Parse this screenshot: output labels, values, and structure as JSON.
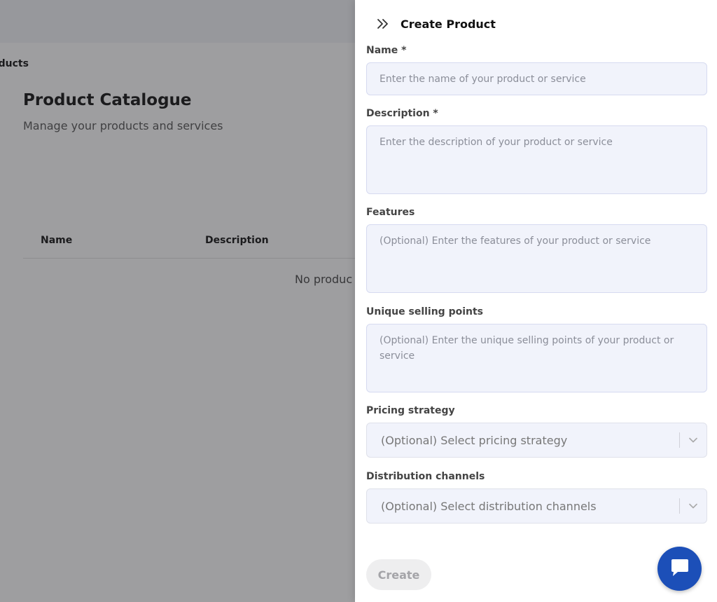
{
  "background": {
    "breadcrumb": "oducts",
    "title": "Product Catalogue",
    "subtitle": "Manage your products and services",
    "table": {
      "headers": [
        "Name",
        "Description"
      ],
      "empty_text": "No produc"
    }
  },
  "drawer": {
    "title": "Create Product",
    "fields": {
      "name": {
        "label": "Name *",
        "placeholder": "Enter the name of your product or service"
      },
      "description": {
        "label": "Description *",
        "placeholder": "Enter the description of your product or service"
      },
      "features": {
        "label": "Features",
        "placeholder": "(Optional) Enter the features of your product or service"
      },
      "usp": {
        "label": "Unique selling points",
        "placeholder": "(Optional) Enter the unique selling points of your product or service"
      },
      "pricing": {
        "label": "Pricing strategy",
        "placeholder": "(Optional) Select pricing strategy"
      },
      "distribution": {
        "label": "Distribution channels",
        "placeholder": "(Optional) Select distribution channels"
      }
    },
    "create_label": "Create"
  },
  "icons": {
    "collapse": "double-chevron-right-icon",
    "chevron": "chevron-down-icon",
    "chat": "chat-bubble-icon"
  },
  "colors": {
    "accent": "#1c4fb8",
    "field_bg": "#f1f3fb",
    "field_border": "#d6daf0",
    "overlay": "rgba(40,40,45,0.45)"
  }
}
